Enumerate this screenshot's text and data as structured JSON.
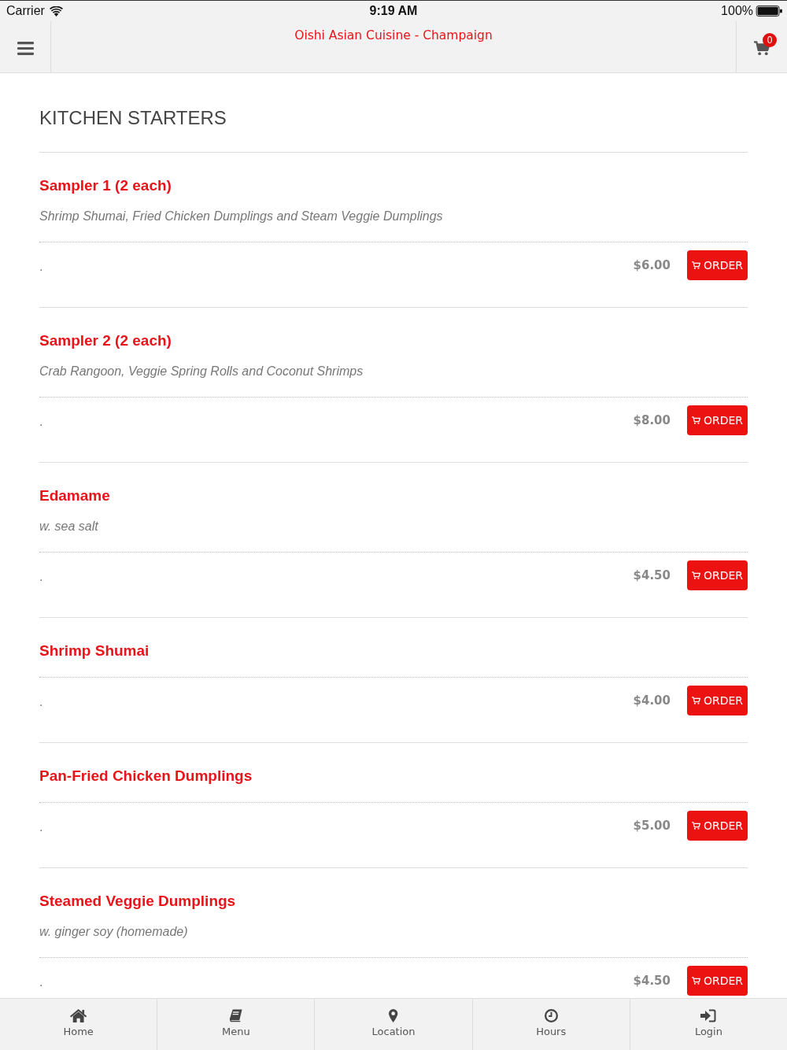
{
  "status_bar": {
    "carrier": "Carrier",
    "time": "9:19 AM",
    "battery": "100%"
  },
  "header": {
    "title": "Oishi Asian Cuisine - Champaign",
    "cart_count": "0"
  },
  "section": {
    "title": "KITCHEN STARTERS"
  },
  "items": [
    {
      "name": "Sampler 1 (2 each)",
      "description": "Shrimp Shumai, Fried Chicken Dumplings and Steam Veggie Dumplings",
      "note": ".",
      "price": "$6.00",
      "button": "ORDER"
    },
    {
      "name": "Sampler 2 (2 each)",
      "description": "Crab Rangoon, Veggie Spring Rolls and Coconut Shrimps",
      "note": ".",
      "price": "$8.00",
      "button": "ORDER"
    },
    {
      "name": "Edamame",
      "description": "w. sea salt",
      "note": ".",
      "price": "$4.50",
      "button": "ORDER"
    },
    {
      "name": "Shrimp Shumai",
      "note": ".",
      "price": "$4.00",
      "button": "ORDER"
    },
    {
      "name": "Pan-Fried Chicken Dumplings",
      "note": ".",
      "price": "$5.00",
      "button": "ORDER"
    },
    {
      "name": "Steamed Veggie Dumplings",
      "description": "w. ginger soy (homemade)",
      "note": ".",
      "price": "$4.50",
      "button": "ORDER"
    }
  ],
  "tab_bar": [
    {
      "label": "Home"
    },
    {
      "label": "Menu"
    },
    {
      "label": "Location"
    },
    {
      "label": "Hours"
    },
    {
      "label": "Login"
    }
  ]
}
